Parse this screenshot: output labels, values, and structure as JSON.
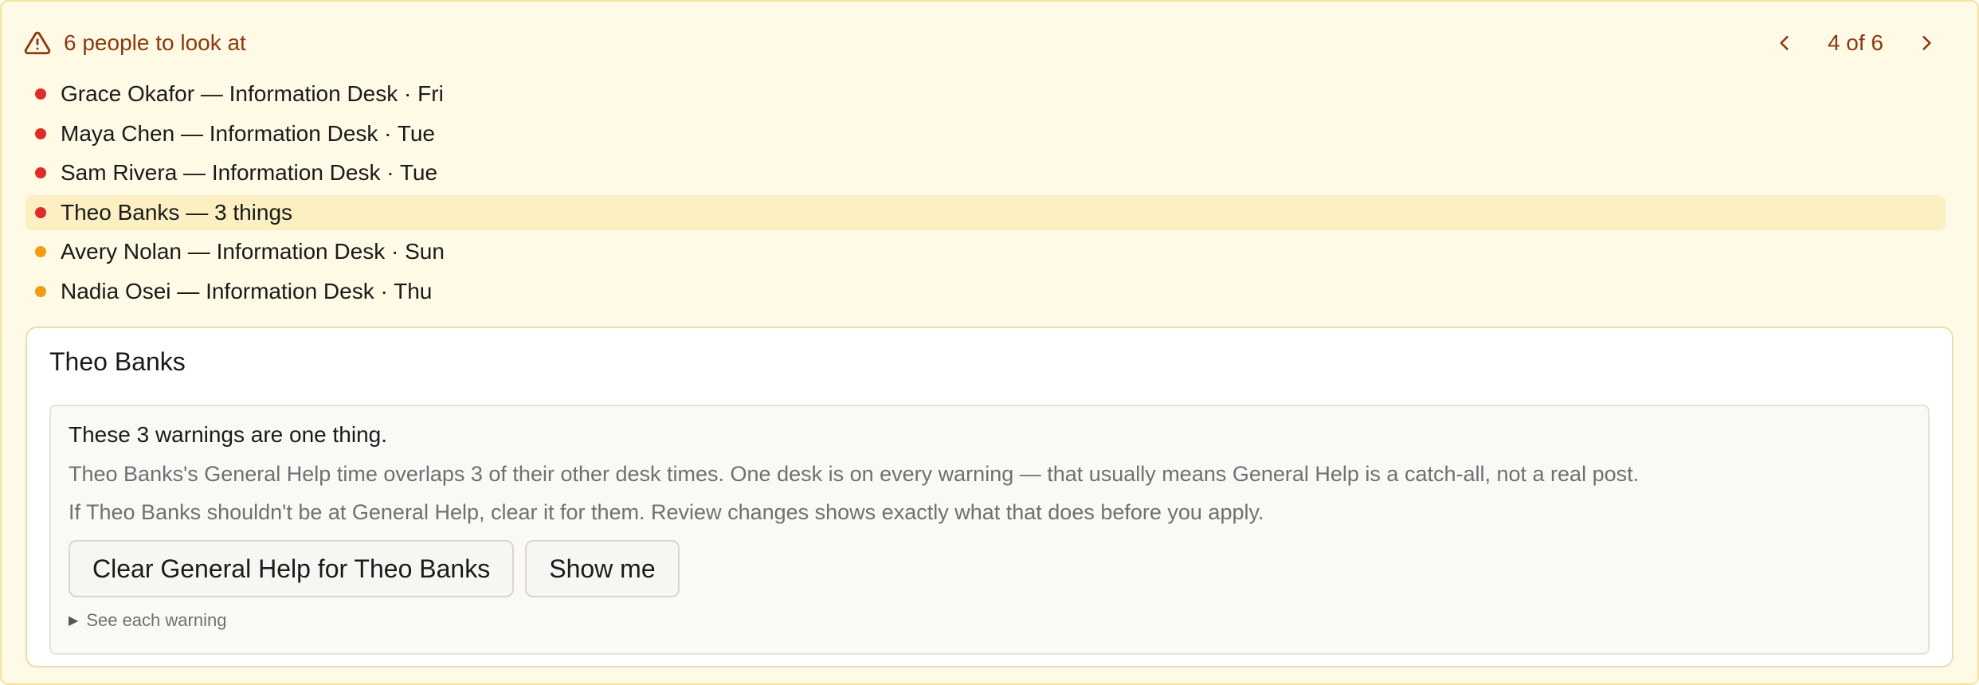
{
  "header": {
    "icon": "warning-triangle-icon",
    "title": "6 people to look at",
    "pager": {
      "text": "4 of 6",
      "prev_icon": "chevron-left-icon",
      "next_icon": "chevron-right-icon"
    }
  },
  "colors": {
    "red": "#e02b2b",
    "orange": "#f39c12",
    "accent_text": "#8a3a0e"
  },
  "people": [
    {
      "label": "Grace Okafor — Information Desk · Fri",
      "severity": "red"
    },
    {
      "label": "Maya Chen — Information Desk · Tue",
      "severity": "red"
    },
    {
      "label": "Sam Rivera — Information Desk · Tue",
      "severity": "red"
    },
    {
      "label": "Theo Banks — 3 things",
      "severity": "red",
      "selected": true
    },
    {
      "label": "Avery Nolan — Information Desk · Sun",
      "severity": "orange"
    },
    {
      "label": "Nadia Osei — Information Desk · Thu",
      "severity": "orange"
    }
  ],
  "detail": {
    "name": "Theo Banks",
    "card": {
      "heading": "These 3 warnings are one thing.",
      "line1": "Theo Banks's General Help time overlaps 3 of their other desk times. One desk is on every warning — that usually means General Help is a catch-all, not a real post.",
      "line2": "If Theo Banks shouldn't be at General Help, clear it for them. Review changes shows exactly what that does before you apply.",
      "primary_button": "Clear General Help for Theo Banks",
      "secondary_button": "Show me",
      "disclosure": "See each warning"
    }
  }
}
